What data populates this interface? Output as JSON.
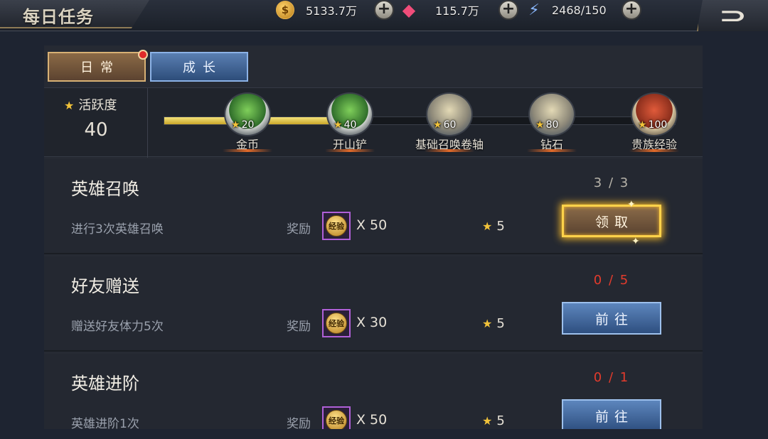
{
  "header": {
    "title": "每日任务",
    "resources": [
      {
        "icon": "coin-icon",
        "glyph": "$",
        "value": "5133.7万"
      },
      {
        "icon": "gem-icon",
        "glyph": "◆",
        "value": "115.7万"
      },
      {
        "icon": "energy-icon",
        "glyph": "⚡",
        "value": "2468/150"
      }
    ],
    "plus_glyph": "+",
    "back_glyph": "⊃"
  },
  "tabs": [
    {
      "label": "日常",
      "selected": true,
      "has_notification": true
    },
    {
      "label": "成长",
      "selected": false
    }
  ],
  "activity": {
    "label": "活跃度",
    "value": "40",
    "progress_fraction": 0.33,
    "milestones": [
      {
        "points": "20",
        "name": "金币",
        "chest": "green"
      },
      {
        "points": "40",
        "name": "开山铲",
        "chest": "green"
      },
      {
        "points": "60",
        "name": "基础召唤卷轴",
        "chest": "gold"
      },
      {
        "points": "80",
        "name": "钻石",
        "chest": "gold"
      },
      {
        "points": "100",
        "name": "贵族经验",
        "chest": "red"
      }
    ]
  },
  "tasks": [
    {
      "title": "英雄召唤",
      "desc": "进行3次英雄召唤",
      "reward_label": "奖励",
      "reward_icon_text": "经验",
      "reward_count": "X 50",
      "points": "5",
      "progress": "3 / 3",
      "button": "领取",
      "status": "complete"
    },
    {
      "title": "好友赠送",
      "desc": "赠送好友体力5次",
      "reward_label": "奖励",
      "reward_icon_text": "经验",
      "reward_count": "X 30",
      "points": "5",
      "progress": "0 / 5",
      "button": "前往",
      "status": "incomplete"
    },
    {
      "title": "英雄进阶",
      "desc": "英雄进阶1次",
      "reward_label": "奖励",
      "reward_icon_text": "经验",
      "reward_count": "X 50",
      "points": "5",
      "progress": "0 / 1",
      "button": "前往",
      "status": "incomplete"
    }
  ],
  "colors": {
    "accent_gold": "#f2c33a",
    "incomplete_red": "#e33b2c",
    "claim_glow": "#ffd24a"
  }
}
